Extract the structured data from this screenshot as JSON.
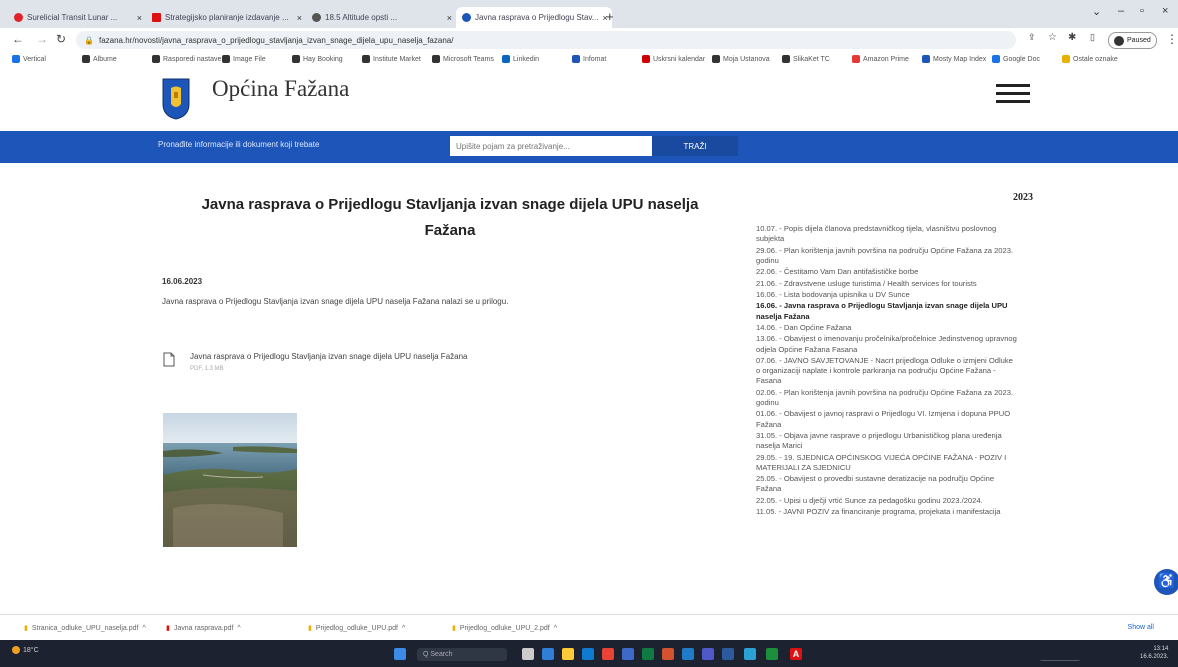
{
  "browser": {
    "tabs": [
      {
        "label": "Surelicial Transit Lunar ...",
        "color": "#e0222a"
      },
      {
        "label": "Strategijsko planiranje izdavanje ...",
        "color": "#d11"
      },
      {
        "label": "18.5 Altitude opsti ...",
        "color": "#555"
      },
      {
        "label": "Javna rasprava o Prijedlogu Stav...",
        "color": "#1d56b8"
      }
    ],
    "new_tab": "+",
    "url": "fazana.hr/novosti/javna_rasprava_o_prijedlogu_stavljanja_izvan_snage_dijela_upu_naselja_fazana/",
    "profile_label": "Paused",
    "bookmarks": [
      "Vertical",
      "Albume",
      "Rasporedi nastave",
      "Image File",
      "Hay Booking",
      "Institute Market",
      "Microsoft Teams",
      "Linkedin",
      "Infomat",
      "Uskrsni kalendar",
      "Moja Ustanova",
      "SlikaKet TC",
      "Amazon Prime",
      "Mosty Map Index",
      "Google Doc",
      "Ostale oznake"
    ]
  },
  "site": {
    "title": "Općina Fažana",
    "bar_text": "Pronađite informacije ili dokument koji trebate",
    "search_placeholder": "Upišite pojam za pretraživanje...",
    "search_button": "TRAŽI"
  },
  "article": {
    "title_line1": "Javna rasprava o Prijedlogu Stavljanja izvan snage dijela UPU naselja",
    "title_line2": "Fažana",
    "date": "16.06.2023",
    "text": "Javna rasprava o Prijedlogu Stavljanja izvan snage dijela UPU naselja Fažana nalazi se u prilogu.",
    "document_title": "Javna rasprava o Prijedlogu Stavljanja izvan snage dijela UPU naselja Fažana",
    "document_meta": "PDF, 1.3 MB"
  },
  "sidebar": {
    "year": "2023",
    "items": [
      {
        "text": "10.07. - Popis dijela članova predstavničkog tijela, vlasništvu poslovnog subjekta",
        "bold": false
      },
      {
        "text": "29.06. - Plan korištenja javnih površina na području Općine Fažana za 2023. godinu",
        "bold": false
      },
      {
        "text": "22.06. - Čestitamo Vam Dan antifašističke borbe",
        "bold": false
      },
      {
        "text": "21.06. - Zdravstvene usluge turistima / Health services for tourists",
        "bold": false
      },
      {
        "text": "16.06. - Lista bodovanja upisnika u DV Sunce",
        "bold": false
      },
      {
        "text": "16.06. - Javna rasprava o Prijedlogu Stavljanja izvan snage dijela UPU naselja Fažana",
        "bold": true
      },
      {
        "text": "14.06. - Dan Općine Fažana",
        "bold": false
      },
      {
        "text": "13.06. - Obavijest o imenovanju pročelnika/pročelnice Jedinstvenog upravnog odjela Općine Fažana Fasana",
        "bold": false
      },
      {
        "text": "07.06. - JAVNO SAVJETOVANJE - Nacrt prijedloga Odluke o izmjeni Odluke o organizaciji naplate i kontrole parkiranja na području Općine Fažana - Fasana",
        "bold": false
      },
      {
        "text": "02.06. - Plan korištenja javnih površina na području Općine Fažana za 2023. godinu",
        "bold": false
      },
      {
        "text": "01.06. - Obavijest o javnoj raspravi o Prijedlogu VI. Izmjena i dopuna PPUO Fažana",
        "bold": false
      },
      {
        "text": "31.05. - Objava javne rasprave o prijedlogu Urbanističkog plana uređenja naselja Marici",
        "bold": false
      },
      {
        "text": "29.05. - 19. SJEDNICA OPĆINSKOG VIJEĆA OPĆINE FAŽANA - POZIV I MATERIJALI ZA SJEDNICU",
        "bold": false
      },
      {
        "text": "25.05. - Obavijest o provedbi sustavne deratizacije na području Općine Fažana",
        "bold": false
      },
      {
        "text": "22.05. - Upisi u dječji vrtić Sunce za pedagošku godinu 2023./2024.",
        "bold": false
      },
      {
        "text": "11.05. - JAVNI POZIV za financiranje programa, projekata i manifestacija",
        "bold": false
      }
    ]
  },
  "downloads": {
    "items": [
      "Stranica_odluke_UPU_naselja.pdf",
      "Javna rasprava.pdf",
      "Prijedlog_odluke_UPU.pdf",
      "Prijedlog_odluke_UPU_2.pdf"
    ],
    "show_all": "Show all"
  },
  "taskbar": {
    "weather": "18°C",
    "search": "Q Search",
    "time": "13:14",
    "date": "16.6.2023."
  }
}
